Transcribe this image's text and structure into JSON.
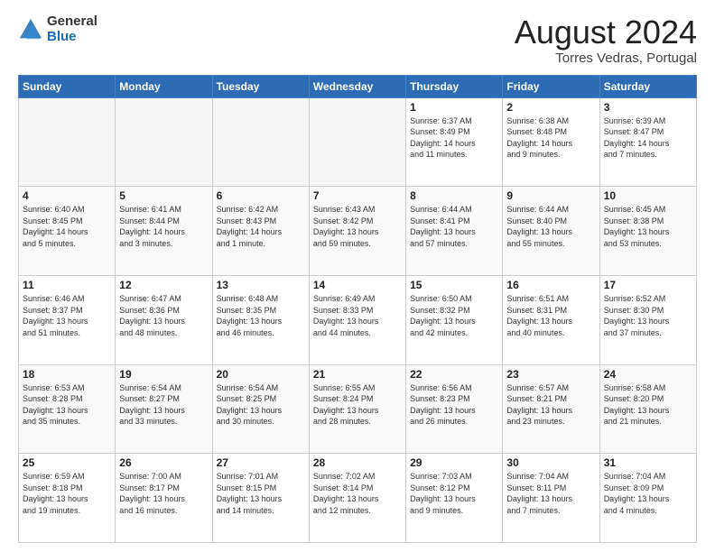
{
  "header": {
    "logo_general": "General",
    "logo_blue": "Blue",
    "month_title": "August 2024",
    "location": "Torres Vedras, Portugal"
  },
  "weekdays": [
    "Sunday",
    "Monday",
    "Tuesday",
    "Wednesday",
    "Thursday",
    "Friday",
    "Saturday"
  ],
  "weeks": [
    [
      {
        "day": "",
        "info": ""
      },
      {
        "day": "",
        "info": ""
      },
      {
        "day": "",
        "info": ""
      },
      {
        "day": "",
        "info": ""
      },
      {
        "day": "1",
        "info": "Sunrise: 6:37 AM\nSunset: 8:49 PM\nDaylight: 14 hours\nand 11 minutes."
      },
      {
        "day": "2",
        "info": "Sunrise: 6:38 AM\nSunset: 8:48 PM\nDaylight: 14 hours\nand 9 minutes."
      },
      {
        "day": "3",
        "info": "Sunrise: 6:39 AM\nSunset: 8:47 PM\nDaylight: 14 hours\nand 7 minutes."
      }
    ],
    [
      {
        "day": "4",
        "info": "Sunrise: 6:40 AM\nSunset: 8:45 PM\nDaylight: 14 hours\nand 5 minutes."
      },
      {
        "day": "5",
        "info": "Sunrise: 6:41 AM\nSunset: 8:44 PM\nDaylight: 14 hours\nand 3 minutes."
      },
      {
        "day": "6",
        "info": "Sunrise: 6:42 AM\nSunset: 8:43 PM\nDaylight: 14 hours\nand 1 minute."
      },
      {
        "day": "7",
        "info": "Sunrise: 6:43 AM\nSunset: 8:42 PM\nDaylight: 13 hours\nand 59 minutes."
      },
      {
        "day": "8",
        "info": "Sunrise: 6:44 AM\nSunset: 8:41 PM\nDaylight: 13 hours\nand 57 minutes."
      },
      {
        "day": "9",
        "info": "Sunrise: 6:44 AM\nSunset: 8:40 PM\nDaylight: 13 hours\nand 55 minutes."
      },
      {
        "day": "10",
        "info": "Sunrise: 6:45 AM\nSunset: 8:38 PM\nDaylight: 13 hours\nand 53 minutes."
      }
    ],
    [
      {
        "day": "11",
        "info": "Sunrise: 6:46 AM\nSunset: 8:37 PM\nDaylight: 13 hours\nand 51 minutes."
      },
      {
        "day": "12",
        "info": "Sunrise: 6:47 AM\nSunset: 8:36 PM\nDaylight: 13 hours\nand 48 minutes."
      },
      {
        "day": "13",
        "info": "Sunrise: 6:48 AM\nSunset: 8:35 PM\nDaylight: 13 hours\nand 46 minutes."
      },
      {
        "day": "14",
        "info": "Sunrise: 6:49 AM\nSunset: 8:33 PM\nDaylight: 13 hours\nand 44 minutes."
      },
      {
        "day": "15",
        "info": "Sunrise: 6:50 AM\nSunset: 8:32 PM\nDaylight: 13 hours\nand 42 minutes."
      },
      {
        "day": "16",
        "info": "Sunrise: 6:51 AM\nSunset: 8:31 PM\nDaylight: 13 hours\nand 40 minutes."
      },
      {
        "day": "17",
        "info": "Sunrise: 6:52 AM\nSunset: 8:30 PM\nDaylight: 13 hours\nand 37 minutes."
      }
    ],
    [
      {
        "day": "18",
        "info": "Sunrise: 6:53 AM\nSunset: 8:28 PM\nDaylight: 13 hours\nand 35 minutes."
      },
      {
        "day": "19",
        "info": "Sunrise: 6:54 AM\nSunset: 8:27 PM\nDaylight: 13 hours\nand 33 minutes."
      },
      {
        "day": "20",
        "info": "Sunrise: 6:54 AM\nSunset: 8:25 PM\nDaylight: 13 hours\nand 30 minutes."
      },
      {
        "day": "21",
        "info": "Sunrise: 6:55 AM\nSunset: 8:24 PM\nDaylight: 13 hours\nand 28 minutes."
      },
      {
        "day": "22",
        "info": "Sunrise: 6:56 AM\nSunset: 8:23 PM\nDaylight: 13 hours\nand 26 minutes."
      },
      {
        "day": "23",
        "info": "Sunrise: 6:57 AM\nSunset: 8:21 PM\nDaylight: 13 hours\nand 23 minutes."
      },
      {
        "day": "24",
        "info": "Sunrise: 6:58 AM\nSunset: 8:20 PM\nDaylight: 13 hours\nand 21 minutes."
      }
    ],
    [
      {
        "day": "25",
        "info": "Sunrise: 6:59 AM\nSunset: 8:18 PM\nDaylight: 13 hours\nand 19 minutes."
      },
      {
        "day": "26",
        "info": "Sunrise: 7:00 AM\nSunset: 8:17 PM\nDaylight: 13 hours\nand 16 minutes."
      },
      {
        "day": "27",
        "info": "Sunrise: 7:01 AM\nSunset: 8:15 PM\nDaylight: 13 hours\nand 14 minutes."
      },
      {
        "day": "28",
        "info": "Sunrise: 7:02 AM\nSunset: 8:14 PM\nDaylight: 13 hours\nand 12 minutes."
      },
      {
        "day": "29",
        "info": "Sunrise: 7:03 AM\nSunset: 8:12 PM\nDaylight: 13 hours\nand 9 minutes."
      },
      {
        "day": "30",
        "info": "Sunrise: 7:04 AM\nSunset: 8:11 PM\nDaylight: 13 hours\nand 7 minutes."
      },
      {
        "day": "31",
        "info": "Sunrise: 7:04 AM\nSunset: 8:09 PM\nDaylight: 13 hours\nand 4 minutes."
      }
    ]
  ]
}
